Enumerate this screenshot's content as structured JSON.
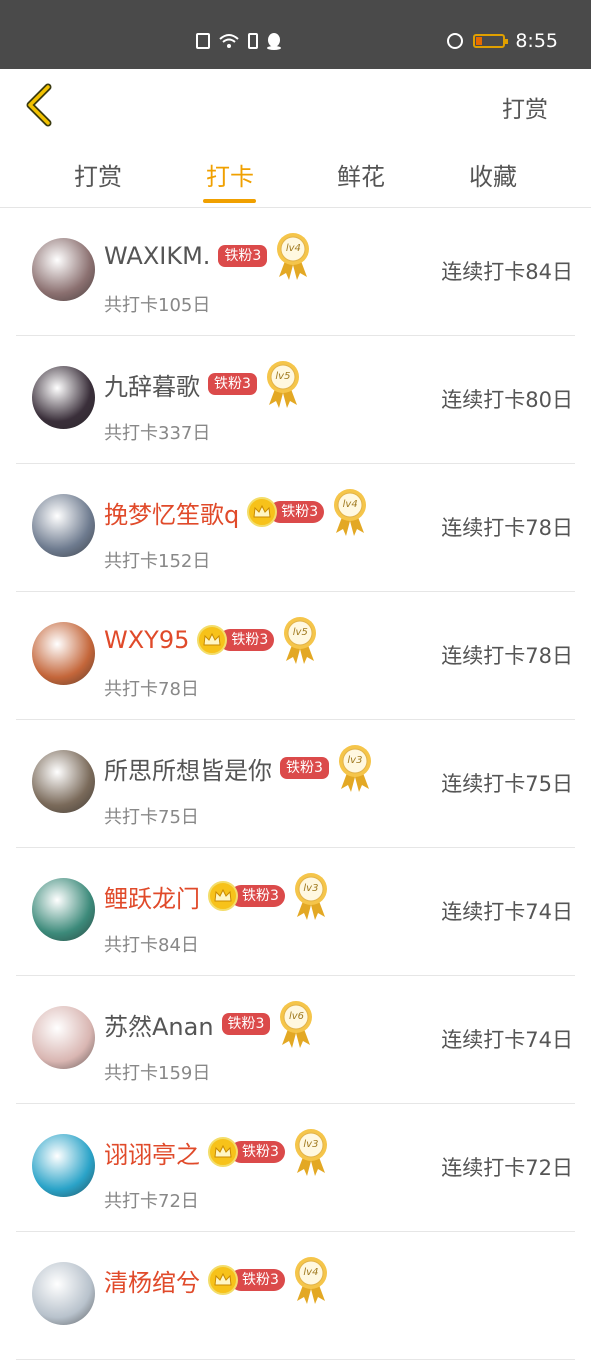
{
  "status_bar": {
    "time": "8:55"
  },
  "header": {
    "title": "打赏"
  },
  "tabs": [
    {
      "label": "打赏",
      "active": false
    },
    {
      "label": "打卡",
      "active": true
    },
    {
      "label": "鲜花",
      "active": false
    },
    {
      "label": "收藏",
      "active": false
    }
  ],
  "colors": {
    "accent": "#f0a000",
    "vip_name": "#e04a2a",
    "fan_badge": "#db4a4a"
  },
  "list": [
    {
      "name": "WAXIKM.",
      "vip": false,
      "crown": false,
      "fan": "铁粉3",
      "level": "lv4",
      "total": "共打卡105日",
      "streak": "连续打卡84日",
      "avatar": "#8b7070"
    },
    {
      "name": "九辞暮歌",
      "vip": false,
      "crown": false,
      "fan": "铁粉3",
      "level": "lv5",
      "total": "共打卡337日",
      "streak": "连续打卡80日",
      "avatar": "#3a2f3a"
    },
    {
      "name": "挽梦忆笙歌q",
      "vip": true,
      "crown": true,
      "fan": "铁粉3",
      "level": "lv4",
      "total": "共打卡152日",
      "streak": "连续打卡78日",
      "avatar": "#6e7b8f"
    },
    {
      "name": "WXY95",
      "vip": true,
      "crown": true,
      "fan": "铁粉3",
      "level": "lv5",
      "total": "共打卡78日",
      "streak": "连续打卡78日",
      "avatar": "#c4663a"
    },
    {
      "name": "所思所想皆是你",
      "vip": false,
      "crown": false,
      "fan": "铁粉3",
      "level": "lv3",
      "total": "共打卡75日",
      "streak": "连续打卡75日",
      "avatar": "#7a6a5a"
    },
    {
      "name": "鲤跃龙门",
      "vip": true,
      "crown": true,
      "fan": "铁粉3",
      "level": "lv3",
      "total": "共打卡84日",
      "streak": "连续打卡74日",
      "avatar": "#3c8a7a"
    },
    {
      "name": "苏然Anan",
      "vip": false,
      "crown": false,
      "fan": "铁粉3",
      "level": "lv6",
      "total": "共打卡159日",
      "streak": "连续打卡74日",
      "avatar": "#d9b6b2"
    },
    {
      "name": "诩诩亭之",
      "vip": true,
      "crown": true,
      "fan": "铁粉3",
      "level": "lv3",
      "total": "共打卡72日",
      "streak": "连续打卡72日",
      "avatar": "#2aa3c8"
    },
    {
      "name": "清杨绾兮",
      "vip": true,
      "crown": true,
      "fan": "铁粉3",
      "level": "lv4",
      "total": "",
      "streak": "",
      "avatar": "#b8c2cc"
    }
  ]
}
